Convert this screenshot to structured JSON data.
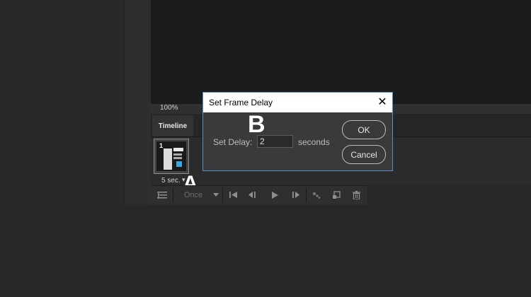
{
  "status": {
    "zoom": "100%"
  },
  "panel": {
    "tab": "Timeline"
  },
  "frame": {
    "number": "1",
    "delay": "5 sec.",
    "delay_chevron": "▾"
  },
  "controls": {
    "loop": "Once",
    "icons": [
      "convert-to-video-timeline-icon",
      "loop-dropdown-icon",
      "first-frame-icon",
      "previous-frame-icon",
      "play-icon",
      "next-frame-icon",
      "tween-icon",
      "duplicate-frame-icon",
      "delete-frame-icon"
    ]
  },
  "callouts": {
    "a": "A",
    "b": "B"
  },
  "dialog": {
    "title": "Set Frame Delay",
    "close": "✕",
    "delay_label": "Set Delay:",
    "delay_value": "2",
    "unit": "seconds",
    "ok": "OK",
    "cancel": "Cancel"
  },
  "colors": {
    "accent_border": "#5a8fd0",
    "bg": "#282828"
  }
}
